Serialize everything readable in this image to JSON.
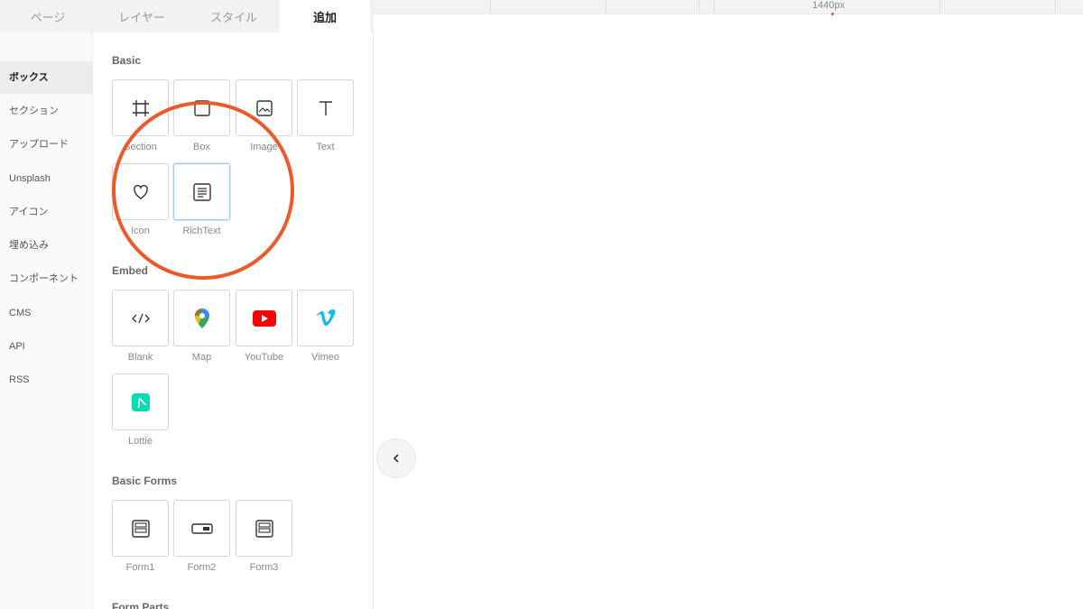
{
  "tabs": [
    {
      "label": "ページ"
    },
    {
      "label": "レイヤー"
    },
    {
      "label": "スタイル"
    },
    {
      "label": "追加"
    }
  ],
  "categories": [
    {
      "label": "ボックス"
    },
    {
      "label": "セクション"
    },
    {
      "label": "アップロード"
    },
    {
      "label": "Unsplash"
    },
    {
      "label": "アイコン"
    },
    {
      "label": "埋め込み"
    },
    {
      "label": "コンポーネント"
    },
    {
      "label": "CMS"
    },
    {
      "label": "API"
    },
    {
      "label": "RSS"
    }
  ],
  "sections": {
    "basic": {
      "title": "Basic",
      "items": [
        {
          "label": "Section",
          "icon": "section-icon"
        },
        {
          "label": "Box",
          "icon": "box-icon"
        },
        {
          "label": "Image",
          "icon": "image-icon"
        },
        {
          "label": "Text",
          "icon": "text-icon"
        },
        {
          "label": "Icon",
          "icon": "heart-icon"
        },
        {
          "label": "RichText",
          "icon": "richtext-icon"
        }
      ]
    },
    "embed": {
      "title": "Embed",
      "items": [
        {
          "label": "Blank",
          "icon": "code-icon"
        },
        {
          "label": "Map",
          "icon": "map-pin-icon"
        },
        {
          "label": "YouTube",
          "icon": "youtube-icon"
        },
        {
          "label": "Vimeo",
          "icon": "vimeo-icon"
        },
        {
          "label": "Lottie",
          "icon": "lottie-icon"
        }
      ]
    },
    "basic_forms": {
      "title": "Basic Forms",
      "items": [
        {
          "label": "Form1",
          "icon": "form-icon"
        },
        {
          "label": "Form2",
          "icon": "input-icon"
        },
        {
          "label": "Form3",
          "icon": "form-icon"
        }
      ]
    },
    "form_parts": {
      "title": "Form Parts"
    }
  },
  "ruler": {
    "label": "1440px"
  },
  "colors": {
    "highlight": "#ec5a2c",
    "youtube": "#ff0000",
    "vimeo": "#1ab7ea",
    "lottie": "#00ddb3"
  },
  "collapse_button": {
    "icon": "chevron-left-icon"
  }
}
